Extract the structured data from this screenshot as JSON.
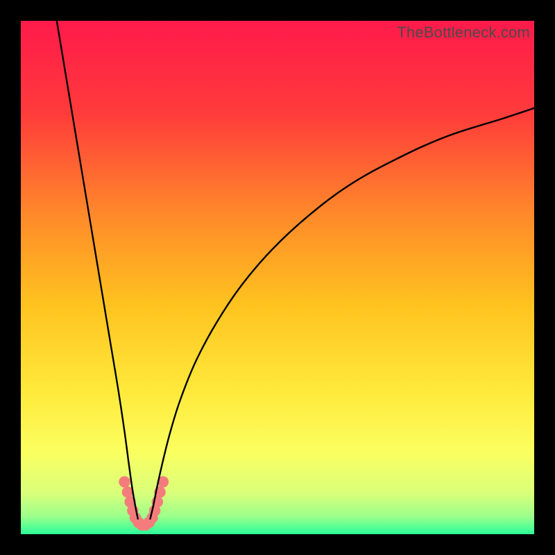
{
  "watermark": "TheBottleneck.com",
  "chart_data": {
    "type": "line",
    "title": "",
    "xlabel": "",
    "ylabel": "",
    "xlim": [
      0,
      100
    ],
    "ylim": [
      0,
      100
    ],
    "grid": false,
    "legend": false,
    "background_gradient": {
      "stops": [
        {
          "pos": 0.0,
          "color": "#ff1a4b"
        },
        {
          "pos": 0.18,
          "color": "#ff3b3b"
        },
        {
          "pos": 0.38,
          "color": "#ff8a2a"
        },
        {
          "pos": 0.55,
          "color": "#ffc21f"
        },
        {
          "pos": 0.72,
          "color": "#ffe93a"
        },
        {
          "pos": 0.84,
          "color": "#fbff60"
        },
        {
          "pos": 0.92,
          "color": "#d9ff7a"
        },
        {
          "pos": 0.965,
          "color": "#9dff8a"
        },
        {
          "pos": 1.0,
          "color": "#2bff9a"
        }
      ]
    },
    "series": [
      {
        "name": "bottleneck-curve-left",
        "color": "#000000",
        "width": 2.4,
        "x": [
          7.0,
          8.5,
          10.0,
          11.5,
          13.0,
          14.5,
          16.0,
          17.5,
          19.0,
          20.2,
          21.0,
          21.7,
          22.3,
          22.8
        ],
        "y": [
          100,
          91,
          82,
          73,
          64,
          55,
          46,
          37,
          28,
          20,
          14,
          9,
          5.5,
          3.0
        ]
      },
      {
        "name": "bottleneck-curve-right",
        "color": "#000000",
        "width": 2.4,
        "x": [
          25.2,
          25.8,
          26.5,
          27.5,
          29.0,
          31.0,
          34.0,
          38.0,
          43.0,
          49.0,
          56.0,
          64.0,
          73.0,
          83.0,
          94.0,
          100.0
        ],
        "y": [
          3.0,
          5.5,
          9.0,
          13.5,
          19.5,
          26.0,
          33.5,
          41.0,
          48.5,
          55.5,
          62.0,
          68.0,
          73.0,
          77.5,
          81.0,
          83.0
        ]
      }
    ],
    "markers": {
      "name": "bottleneck-trough-dots",
      "color": "#f47c7c",
      "radius": 8.2,
      "points": [
        {
          "x": 20.2,
          "y": 10.2
        },
        {
          "x": 20.8,
          "y": 8.2
        },
        {
          "x": 21.3,
          "y": 6.3
        },
        {
          "x": 21.8,
          "y": 4.6
        },
        {
          "x": 22.3,
          "y": 3.2
        },
        {
          "x": 22.9,
          "y": 2.3
        },
        {
          "x": 23.6,
          "y": 1.8
        },
        {
          "x": 24.3,
          "y": 1.8
        },
        {
          "x": 25.0,
          "y": 2.3
        },
        {
          "x": 25.6,
          "y": 3.2
        },
        {
          "x": 26.1,
          "y": 4.6
        },
        {
          "x": 26.6,
          "y": 6.3
        },
        {
          "x": 27.1,
          "y": 8.2
        },
        {
          "x": 27.7,
          "y": 10.2
        }
      ]
    }
  }
}
